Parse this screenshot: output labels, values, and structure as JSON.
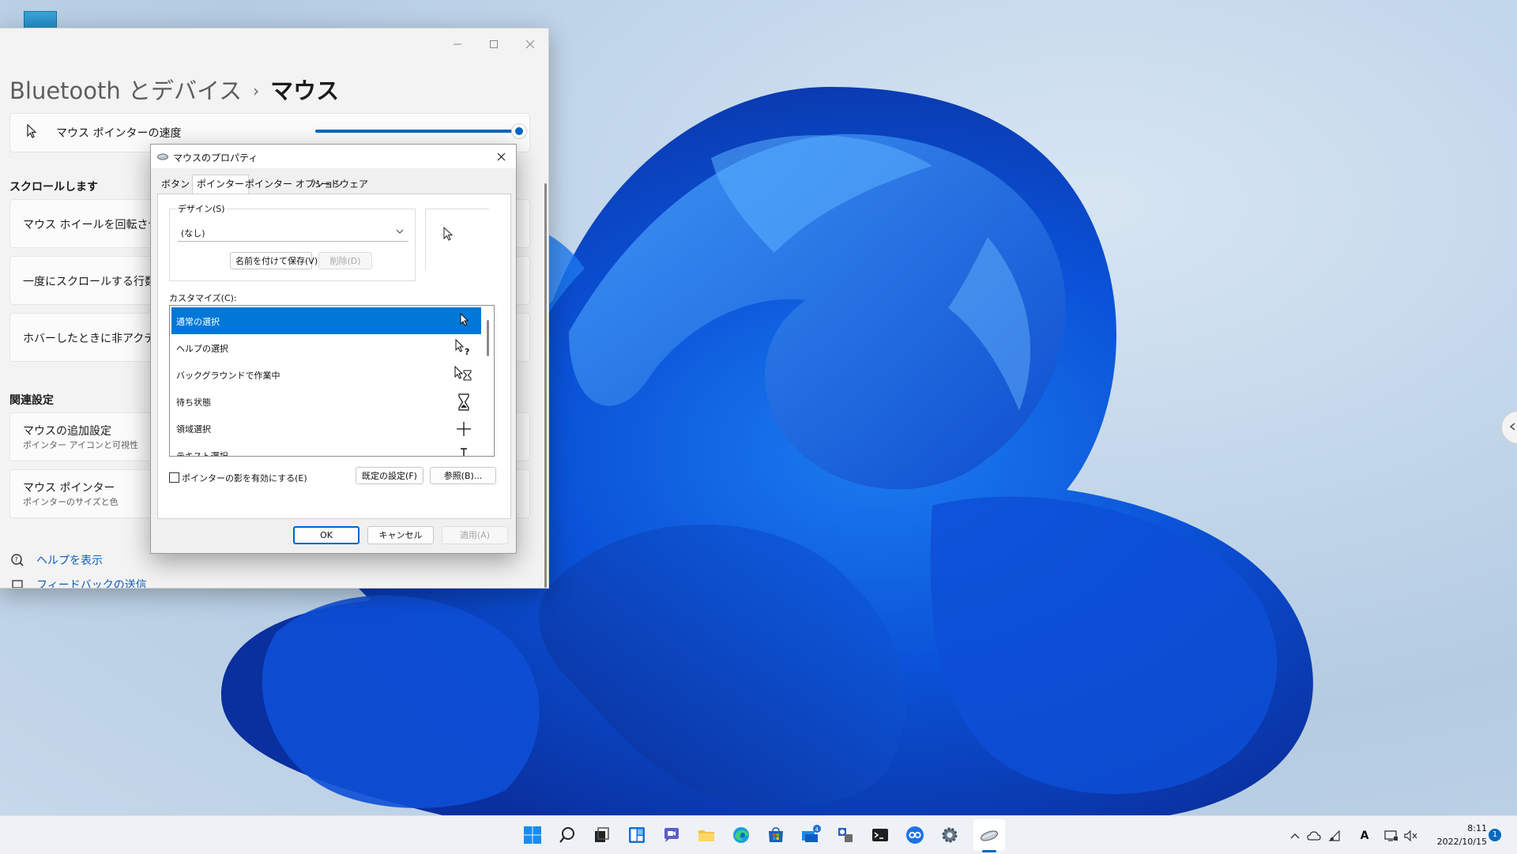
{
  "settings": {
    "breadcrumb_parent": "Bluetooth とデバイス",
    "breadcrumb_separator": "›",
    "breadcrumb_current": "マウス",
    "pointer_speed_label": "マウス ポインターの速度",
    "pointer_speed_level": 0.96,
    "scroll_section": "スクロールします",
    "scroll_rows": [
      "マウス ホイールを回転させてス",
      "一度にスクロールする行数",
      "ホバーしたときに非アクティブ ウ"
    ],
    "related_section": "関連設定",
    "related_items": [
      {
        "title": "マウスの追加設定",
        "subtitle": "ポインター アイコンと可視性"
      },
      {
        "title": "マウス ポインター",
        "subtitle": "ポインターのサイズと色"
      }
    ],
    "help_link": "ヘルプを表示",
    "feedback_link": "フィードバックの送信"
  },
  "dialog": {
    "title": "マウスのプロパティ",
    "tabs": [
      "ボタン",
      "ポインター",
      "ポインター オプション",
      "ハードウェア"
    ],
    "active_tab": "ポインター",
    "design_label": "デザイン(S)",
    "design_value": "(なし)",
    "save_as_button": "名前を付けて保存(V)...",
    "delete_button": "削除(D)",
    "customize_label": "カスタマイズ(C):",
    "pointer_list": [
      "通常の選択",
      "ヘルプの選択",
      "バックグラウンドで作業中",
      "待ち状態",
      "領域選択",
      "テキスト選択"
    ],
    "selected_index": 0,
    "shadow_checkbox_label": "ポインターの影を有効にする(E)",
    "shadow_checked": false,
    "default_button": "既定の設定(F)",
    "browse_button": "参照(B)...",
    "ok_button": "OK",
    "cancel_button": "キャンセル",
    "apply_button": "適用(A)"
  },
  "taskbar": {
    "icons": [
      "windows-start-icon",
      "search-icon",
      "task-view-icon",
      "widgets-icon",
      "teams-chat-icon",
      "file-explorer-icon",
      "edge-icon",
      "store-icon",
      "remote-app-icon",
      "people-app-icon",
      "terminal-icon",
      "link-app-icon",
      "settings-gear-icon",
      "mouse-properties-icon"
    ],
    "badge_count": "4",
    "time": "8:11",
    "date": "2022/10/15",
    "notification_count": "1",
    "ime_indicator": "A"
  }
}
